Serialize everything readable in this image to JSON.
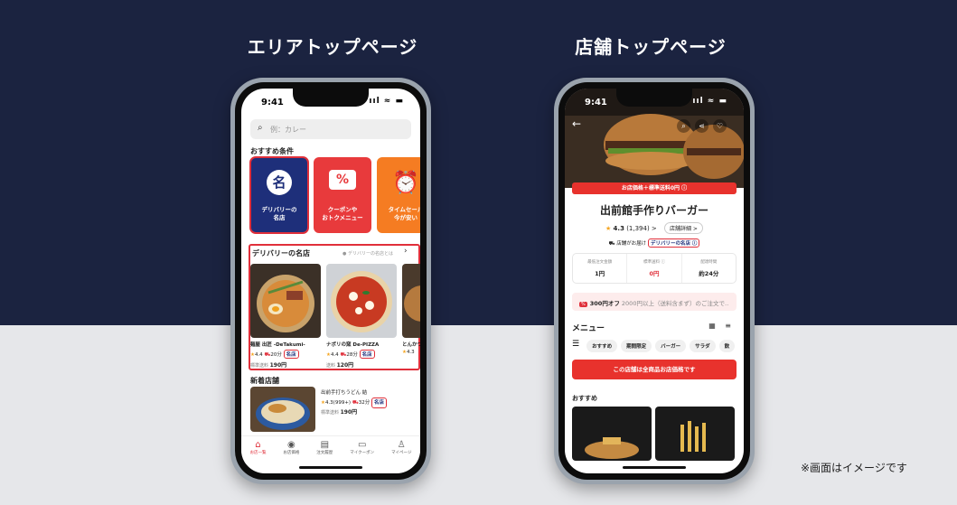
{
  "captions": {
    "left": "エリアトップページ",
    "right": "店舗トップページ"
  },
  "note": "※画面はイメージです",
  "status": {
    "time": "9:41",
    "icons": "ııl ≈ ▬"
  },
  "area_top": {
    "search_placeholder": "例：カレー",
    "section_recommended": "おすすめ条件",
    "conditions": [
      {
        "label": "デリバリーの\n名店",
        "icon": "名"
      },
      {
        "label": "クーポンや\nおトクメニュー",
        "icon": "%"
      },
      {
        "label": "タイムセール\n今が安い",
        "icon": "⏰"
      }
    ],
    "list_title": "デリバリーの名店",
    "list_link": "● デリバリーの名店とは",
    "restaurants": [
      {
        "name": "麺屋 出匠 -DeTakumi-",
        "rating": "4.4",
        "time": "20分",
        "badge": "名店",
        "fee_label": "標準送料",
        "fee": "190円"
      },
      {
        "name": "ナポリの窯 De-PIZZA",
        "rating": "4.4",
        "time": "28分",
        "badge": "名店",
        "fee_label": "送料",
        "fee": "120円"
      },
      {
        "name": "とんかつ",
        "rating": "4.3",
        "time": "",
        "badge": "",
        "fee_label": "",
        "fee": ""
      }
    ],
    "new_title": "新着店舗",
    "new_store": {
      "name": "出前手打ちうどん 結",
      "rating": "4.3(999+)",
      "time": "32分",
      "badge": "名店",
      "fee_label": "標準送料",
      "fee": "190円"
    },
    "tabs": [
      {
        "icon": "⌂",
        "label": "お店一覧"
      },
      {
        "icon": "◉",
        "label": "お店価格"
      },
      {
        "icon": "▤",
        "label": "注文履歴"
      },
      {
        "icon": "▭",
        "label": "マイクーポン"
      },
      {
        "icon": "♙",
        "label": "マイページ"
      }
    ]
  },
  "store_top": {
    "promo": "お店価格＋標準送料0円 ⓘ",
    "name": "出前館手作りバーガー",
    "rating": "4.3",
    "reviews": "(1,394) >",
    "detail_button": "店舗詳細 >",
    "delivery_by": "店舗がお届け",
    "badge": "デリバリーの名店",
    "info": [
      {
        "label": "最低注文金額",
        "value": "1円"
      },
      {
        "label": "標準送料 ⓘ",
        "value": "0円"
      },
      {
        "label": "配達時間",
        "value": "約24分"
      }
    ],
    "coupon_tag": "%",
    "coupon_bold": "300円オフ",
    "coupon_rest": " 2000円以上（送料含まず）のご注文で‥",
    "menu_title": "メニュー",
    "view_icons": "▦ ≡",
    "chips": [
      "おすすめ",
      "期間限定",
      "バーガー",
      "サラダ",
      "飲"
    ],
    "banner": "この店舗は全商品お店価格です",
    "rec_title": "おすすめ"
  }
}
